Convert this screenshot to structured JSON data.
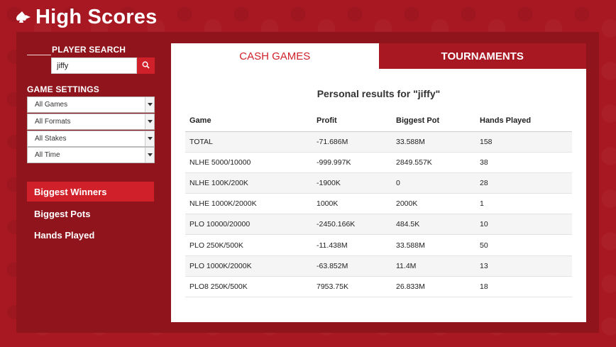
{
  "header": {
    "title": "High Scores",
    "logo_icon": "spade-arrow-icon"
  },
  "sidebar": {
    "player_search_label": "PLAYER SEARCH",
    "search_value": "jiffy",
    "search_placeholder": "",
    "game_settings_label": "GAME SETTINGS",
    "selects": [
      "All Games",
      "All Formats",
      "All Stakes",
      "All Time"
    ],
    "nav": [
      {
        "label": "Biggest Winners",
        "active": true
      },
      {
        "label": "Biggest Pots",
        "active": false
      },
      {
        "label": "Hands Played",
        "active": false
      }
    ]
  },
  "tabs": [
    {
      "label": "CASH GAMES",
      "active": true
    },
    {
      "label": "TOURNAMENTS",
      "active": false
    }
  ],
  "results": {
    "title": "Personal results for \"jiffy\"",
    "columns": [
      "Game",
      "Profit",
      "Biggest Pot",
      "Hands Played"
    ],
    "rows": [
      [
        "TOTAL",
        "-71.686M",
        "33.588M",
        "158"
      ],
      [
        "NLHE 5000/10000",
        "-999.997K",
        "2849.557K",
        "38"
      ],
      [
        "NLHE 100K/200K",
        "-1900K",
        "0",
        "28"
      ],
      [
        "NLHE 1000K/2000K",
        "1000K",
        "2000K",
        "1"
      ],
      [
        "PLO 10000/20000",
        "-2450.166K",
        "484.5K",
        "10"
      ],
      [
        "PLO 250K/500K",
        "-11.438M",
        "33.588M",
        "50"
      ],
      [
        "PLO 1000K/2000K",
        "-63.852M",
        "11.4M",
        "13"
      ],
      [
        "PLO8 250K/500K",
        "7953.75K",
        "26.833M",
        "18"
      ]
    ]
  },
  "colors": {
    "accent": "#d0202a",
    "background": "#a81822",
    "panel": "#8f141c"
  }
}
